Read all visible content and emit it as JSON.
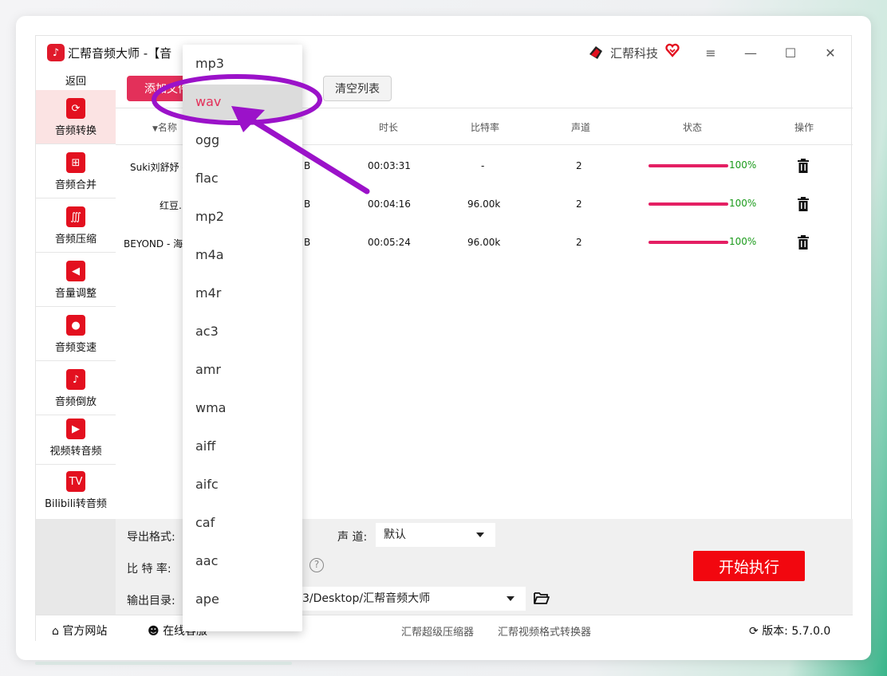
{
  "window": {
    "title": "汇帮音频大师 -【音",
    "brand": "汇帮科技",
    "controls": {
      "menu": "≡",
      "minimize": "—",
      "maximize": "☐",
      "close": "✕"
    }
  },
  "sidebar": {
    "back": "返回",
    "items": [
      {
        "label": "音频转换",
        "icon": "convert-icon",
        "active": true
      },
      {
        "label": "音频合并",
        "icon": "merge-icon"
      },
      {
        "label": "音频压缩",
        "icon": "compress-icon"
      },
      {
        "label": "音量调整",
        "icon": "volume-icon"
      },
      {
        "label": "音频变速",
        "icon": "speed-icon"
      },
      {
        "label": "音频倒放",
        "icon": "reverse-icon"
      },
      {
        "label": "视频转音频",
        "icon": "video-icon"
      },
      {
        "label": "Bilibili转音频",
        "icon": "bilibili-icon"
      }
    ]
  },
  "toolbar": {
    "add": "添加文件",
    "clear": "清空列表"
  },
  "table": {
    "headers": {
      "name": "名称",
      "duration": "时长",
      "bitrate": "比特率",
      "channels": "声道",
      "status": "状态",
      "action": "操作"
    },
    "rows": [
      {
        "name": "Suki刘舒妤 -",
        "size": "B",
        "duration": "00:03:31",
        "bitrate": "-",
        "channels": "2",
        "progress": "100%"
      },
      {
        "name": "红豆.",
        "size": "B",
        "duration": "00:04:16",
        "bitrate": "96.00k",
        "channels": "2",
        "progress": "100%"
      },
      {
        "name": "BEYOND - 海",
        "size": "B",
        "duration": "00:05:24",
        "bitrate": "96.00k",
        "channels": "2",
        "progress": "100%"
      }
    ]
  },
  "settings": {
    "format_label": "导出格式:",
    "channel_label": "声 道:",
    "channel_value": "默认",
    "bitrate_label": "比 特 率:",
    "output_label": "输出目录:",
    "output_path": "3/Desktop/汇帮音频大师",
    "start": "开始执行",
    "help": "?"
  },
  "dropdown": {
    "options": [
      "mp3",
      "wav",
      "ogg",
      "flac",
      "mp2",
      "m4a",
      "m4r",
      "ac3",
      "amr",
      "wma",
      "aiff",
      "aifc",
      "caf",
      "aac",
      "ape"
    ],
    "selected": "wav"
  },
  "footer": {
    "website": "官方网站",
    "online": "在线客服",
    "link1": "汇帮超级压缩器",
    "link2": "汇帮视频格式转换器",
    "version": "版本: 5.7.0.0"
  },
  "colors": {
    "accent": "#e3305a",
    "brand_red": "#e3101f",
    "progress": "#e41f63",
    "annotation": "#9b12c9",
    "percent": "#1a9a1a"
  }
}
